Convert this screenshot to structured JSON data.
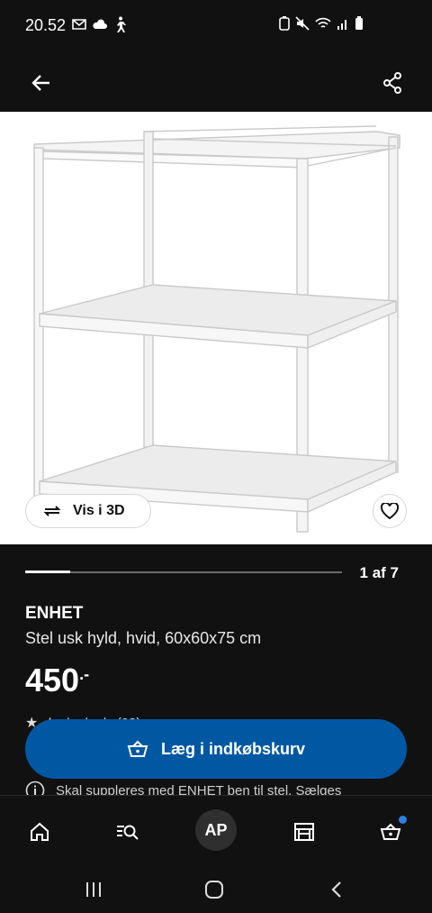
{
  "status_bar": {
    "time": "20.52"
  },
  "product": {
    "name": "ENHET",
    "description": "Stel usk hyld, hvid, 60x60x75 cm",
    "price": "450",
    "price_suffix": ".-",
    "rating_count": "(93)",
    "info_text": "Skal suppleres med ENHET ben til stel. Sælges"
  },
  "gallery": {
    "view_3d_label": "Vis i 3D",
    "page_indicator": "1 af 7",
    "progress_fraction": 0.143
  },
  "actions": {
    "add_to_cart_label": "Læg i indkøbskurv"
  },
  "nav": {
    "avatar_initials": "AP"
  },
  "colors": {
    "accent_blue": "#0058a3",
    "background": "#111111",
    "notification_dot": "#2d7fe0"
  },
  "icons": [
    "arrow-left-icon",
    "share-icon",
    "rotate-3d-icon",
    "heart-icon",
    "star-icon",
    "info-icon",
    "basket-icon",
    "home-icon",
    "search-list-icon",
    "store-icon",
    "cart-icon",
    "menu-lines-icon",
    "home-circle-icon",
    "chevron-left-icon"
  ]
}
